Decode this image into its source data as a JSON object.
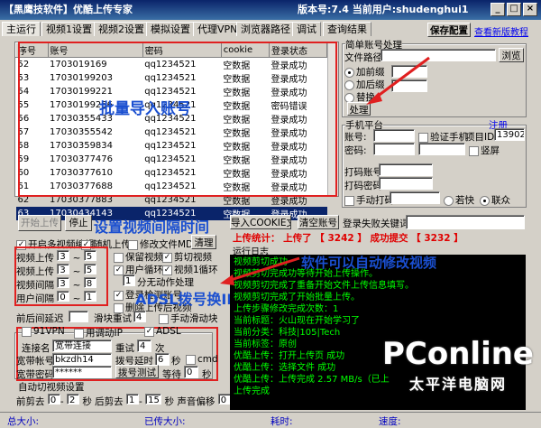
{
  "window": {
    "title": "【黑鹰技软件】优酷上传专家",
    "version_label": "版本号:",
    "version": "7.4",
    "user_label": "当前用户:",
    "user": "shudenghui1",
    "extra_text": "接收 访问主机最后"
  },
  "tabs": [
    "主运行",
    "视频1设置",
    "视频2设置",
    "模拟设置",
    "代理VPN",
    "浏览器路径",
    "调试",
    "查询结果"
  ],
  "toolbar": {
    "save_label": "保存配置",
    "tutorial_label": "查看新版教程"
  },
  "table": {
    "columns": [
      "序号",
      "账号",
      "密码",
      "cookie",
      "登录状态"
    ],
    "rows": [
      [
        "52",
        "1703019169",
        "qq1234521",
        "空数据",
        "登录成功"
      ],
      [
        "53",
        "17030199203",
        "qq1234521",
        "空数据",
        "登录成功"
      ],
      [
        "54",
        "17030199221",
        "qq1234521",
        "空数据",
        "登录成功"
      ],
      [
        "55",
        "17030199256",
        "qq1234521",
        "空数据",
        "密码错误"
      ],
      [
        "56",
        "17030355433",
        "qq1234521",
        "空数据",
        "登录成功"
      ],
      [
        "57",
        "17030355542",
        "qq1234521",
        "空数据",
        "登录成功"
      ],
      [
        "58",
        "17030359834",
        "qq1234521",
        "空数据",
        "登录成功"
      ],
      [
        "59",
        "17030377476",
        "qq1234521",
        "空数据",
        "登录成功"
      ],
      [
        "60",
        "17030377610",
        "qq1234521",
        "空数据",
        "登录成功"
      ],
      [
        "61",
        "17030377688",
        "qq1234521",
        "空数据",
        "登录成功"
      ],
      [
        "62",
        "17030377883",
        "qq1234521",
        "空数据",
        "登录成功"
      ],
      [
        "63",
        "17030434143",
        "qq1234521",
        "空数据",
        "登录成功"
      ]
    ],
    "selected_index": 11
  },
  "account_group": {
    "title": "简单账号处理",
    "file_path_label": "文件路径",
    "browse_label": "浏览",
    "opt_append": "加前缀",
    "opt_suffix": "加后缀",
    "opt_replace": "替换",
    "process_label": "处理"
  },
  "phone_group": {
    "title": "手机平台",
    "register_label": "注册",
    "account_label": "账号:",
    "password_label": "密码:",
    "verify_label": "验证手机",
    "project_label": "项目ID",
    "project_id": "13902",
    "vertical_label": "竖屏",
    "coder_account_label": "打码账号",
    "coder_password_label": "打码密码",
    "manual_code_label": "手动打码",
    "ruokuai_label": "若快",
    "lianzhong_label": "联众"
  },
  "controls": {
    "start_label": "开始上传",
    "pause_label": "停止",
    "import_cookie_label": "导入COOKIE文件",
    "clear_accounts_label": "清空账号",
    "login_fail_label": "登录失败关键词",
    "enable_video_label": "开启多视频编辑",
    "random_upload_label": "随机上传",
    "modify_md5_label": "修改文件MD5",
    "clear_label": "清理"
  },
  "stats": {
    "upload_total_label": "上传统计：",
    "uploaded_label": "上传了",
    "uploaded_value": "3242",
    "success_label": "成功提交",
    "success_value": "3232"
  },
  "video_settings": {
    "upload_label": "视频上传",
    "upload_min": "3",
    "upload_max": "5",
    "interval_label": "视频间隔",
    "interval_min": "3",
    "interval_max": "8",
    "user_interval_label": "用户间隔",
    "user_interval_min": "0",
    "user_interval_max": "1",
    "video_len_label": "视频上传",
    "video_len_min": "3",
    "video_len_max": "5",
    "keep_label": "保留视频",
    "cut_label": "剪切视频",
    "user_loop_label": "用户循环",
    "video_loop_label": "视频1循环",
    "minutes_auto_label": "分无动作处理",
    "minutes_value": "1",
    "login_check_label": "登录检测账号",
    "delete_video_label": "删除上传后视频",
    "pre_delay_label": "前后间延迟",
    "slide_retry_label": "滑块重试",
    "slide_retry_value": "4",
    "manual_slide_label": "手动滑动块"
  },
  "vpn_group": {
    "title": "91VPN",
    "dialup_label": "用调动IP",
    "adsl_label": "ADSL",
    "conn_name_label": "连接名",
    "conn_name": "宽带连接",
    "retry_label": "重试",
    "retry_value": "4",
    "retry_unit": "次",
    "account_label": "宽带帐号",
    "account": "bkzdh14",
    "delay_label": "拨号延时",
    "delay_value": "6",
    "delay_unit": "秒",
    "cmd_label": "cmd",
    "password_label": "宽带密码",
    "password": "******",
    "dial_test_label": "拨号测试",
    "wait_label": "等待",
    "wait_value": "0",
    "wait_unit": "秒"
  },
  "auto_cut": {
    "title": "自动切视频设置",
    "front_label": "前剪去",
    "front_min": "0",
    "front_max": "2",
    "sec1": "秒",
    "back_label": "后剪去",
    "back_min": "1",
    "back_max": "15",
    "sec2": "秒",
    "volume_label": "声音偏移",
    "volume_value": "0",
    "sec3": "秒"
  },
  "log": {
    "title": "运行日志",
    "lines": [
      "视频剪切成功",
      "视频剪切完成功等待开始上传操作。",
      "视频剪切完成了重备开始文件上传信息填写。",
      "视频剪切完成了开始批量上传。",
      "上传步骤修改完成次数：1",
      "当前标题：火山现在开始学习了",
      "当前分类：科技|105|Tech",
      "当前标签：原创",
      "优酷上传：打开上传页 成功",
      "优酷上传：选择文件 成功",
      "优酷上传：上传完成 2.57 MB/s（已上",
      "上传完成"
    ]
  },
  "annotations": {
    "batch_import": "批量导入账号",
    "set_interval": "设置视频间隔时间",
    "auto_modify": "软件可以自动修改视频",
    "adsl": "ADSL拨号换IP"
  },
  "statusbar": {
    "total_label": "总大小:",
    "uploaded_label": "已传大小:",
    "time_label": "耗时:",
    "speed_label": "速度:"
  },
  "watermark": {
    "brand": "PConline",
    "sub": "太平洋电脑网"
  }
}
